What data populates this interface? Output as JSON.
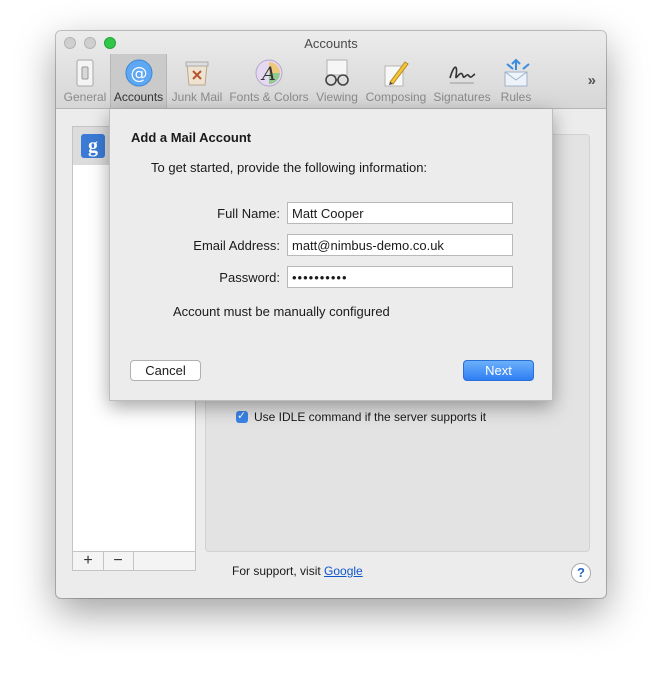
{
  "window": {
    "title": "Accounts"
  },
  "toolbar": {
    "items": [
      {
        "id": "general",
        "label": "General",
        "icon": "switch-icon"
      },
      {
        "id": "accounts",
        "label": "Accounts",
        "icon": "at-sign-icon"
      },
      {
        "id": "junk",
        "label": "Junk Mail",
        "icon": "junk-bin-icon"
      },
      {
        "id": "fonts",
        "label": "Fonts & Colors",
        "icon": "font-a-icon"
      },
      {
        "id": "viewing",
        "label": "Viewing",
        "icon": "glasses-icon"
      },
      {
        "id": "composing",
        "label": "Composing",
        "icon": "pencil-icon"
      },
      {
        "id": "signatures",
        "label": "Signatures",
        "icon": "signature-icon"
      },
      {
        "id": "rules",
        "label": "Rules",
        "icon": "envelope-arrows-icon"
      }
    ],
    "overflow_label": "»"
  },
  "accounts_list": {
    "google_glyph": "g",
    "add_label": "+",
    "remove_label": "−"
  },
  "detail": {
    "idle_label": "Use IDLE command if the server supports it",
    "idle_checked": true
  },
  "footer": {
    "support_prefix": "For support, visit ",
    "support_link": "Google",
    "help_label": "?"
  },
  "sheet": {
    "title": "Add a Mail Account",
    "intro": "To get started, provide the following information:",
    "full_name_label": "Full Name:",
    "full_name_value": "Matt Cooper",
    "email_label": "Email Address:",
    "email_value": "matt@nimbus-demo.co.uk",
    "password_label": "Password:",
    "password_value": "••••••••••",
    "manual_note": "Account must be manually configured",
    "cancel_label": "Cancel",
    "next_label": "Next"
  },
  "colors": {
    "accent": "#2e7ef2",
    "google": "#3b7bd6",
    "close_disabled": "#cfcfcf",
    "zoom_green": "#30c648"
  }
}
